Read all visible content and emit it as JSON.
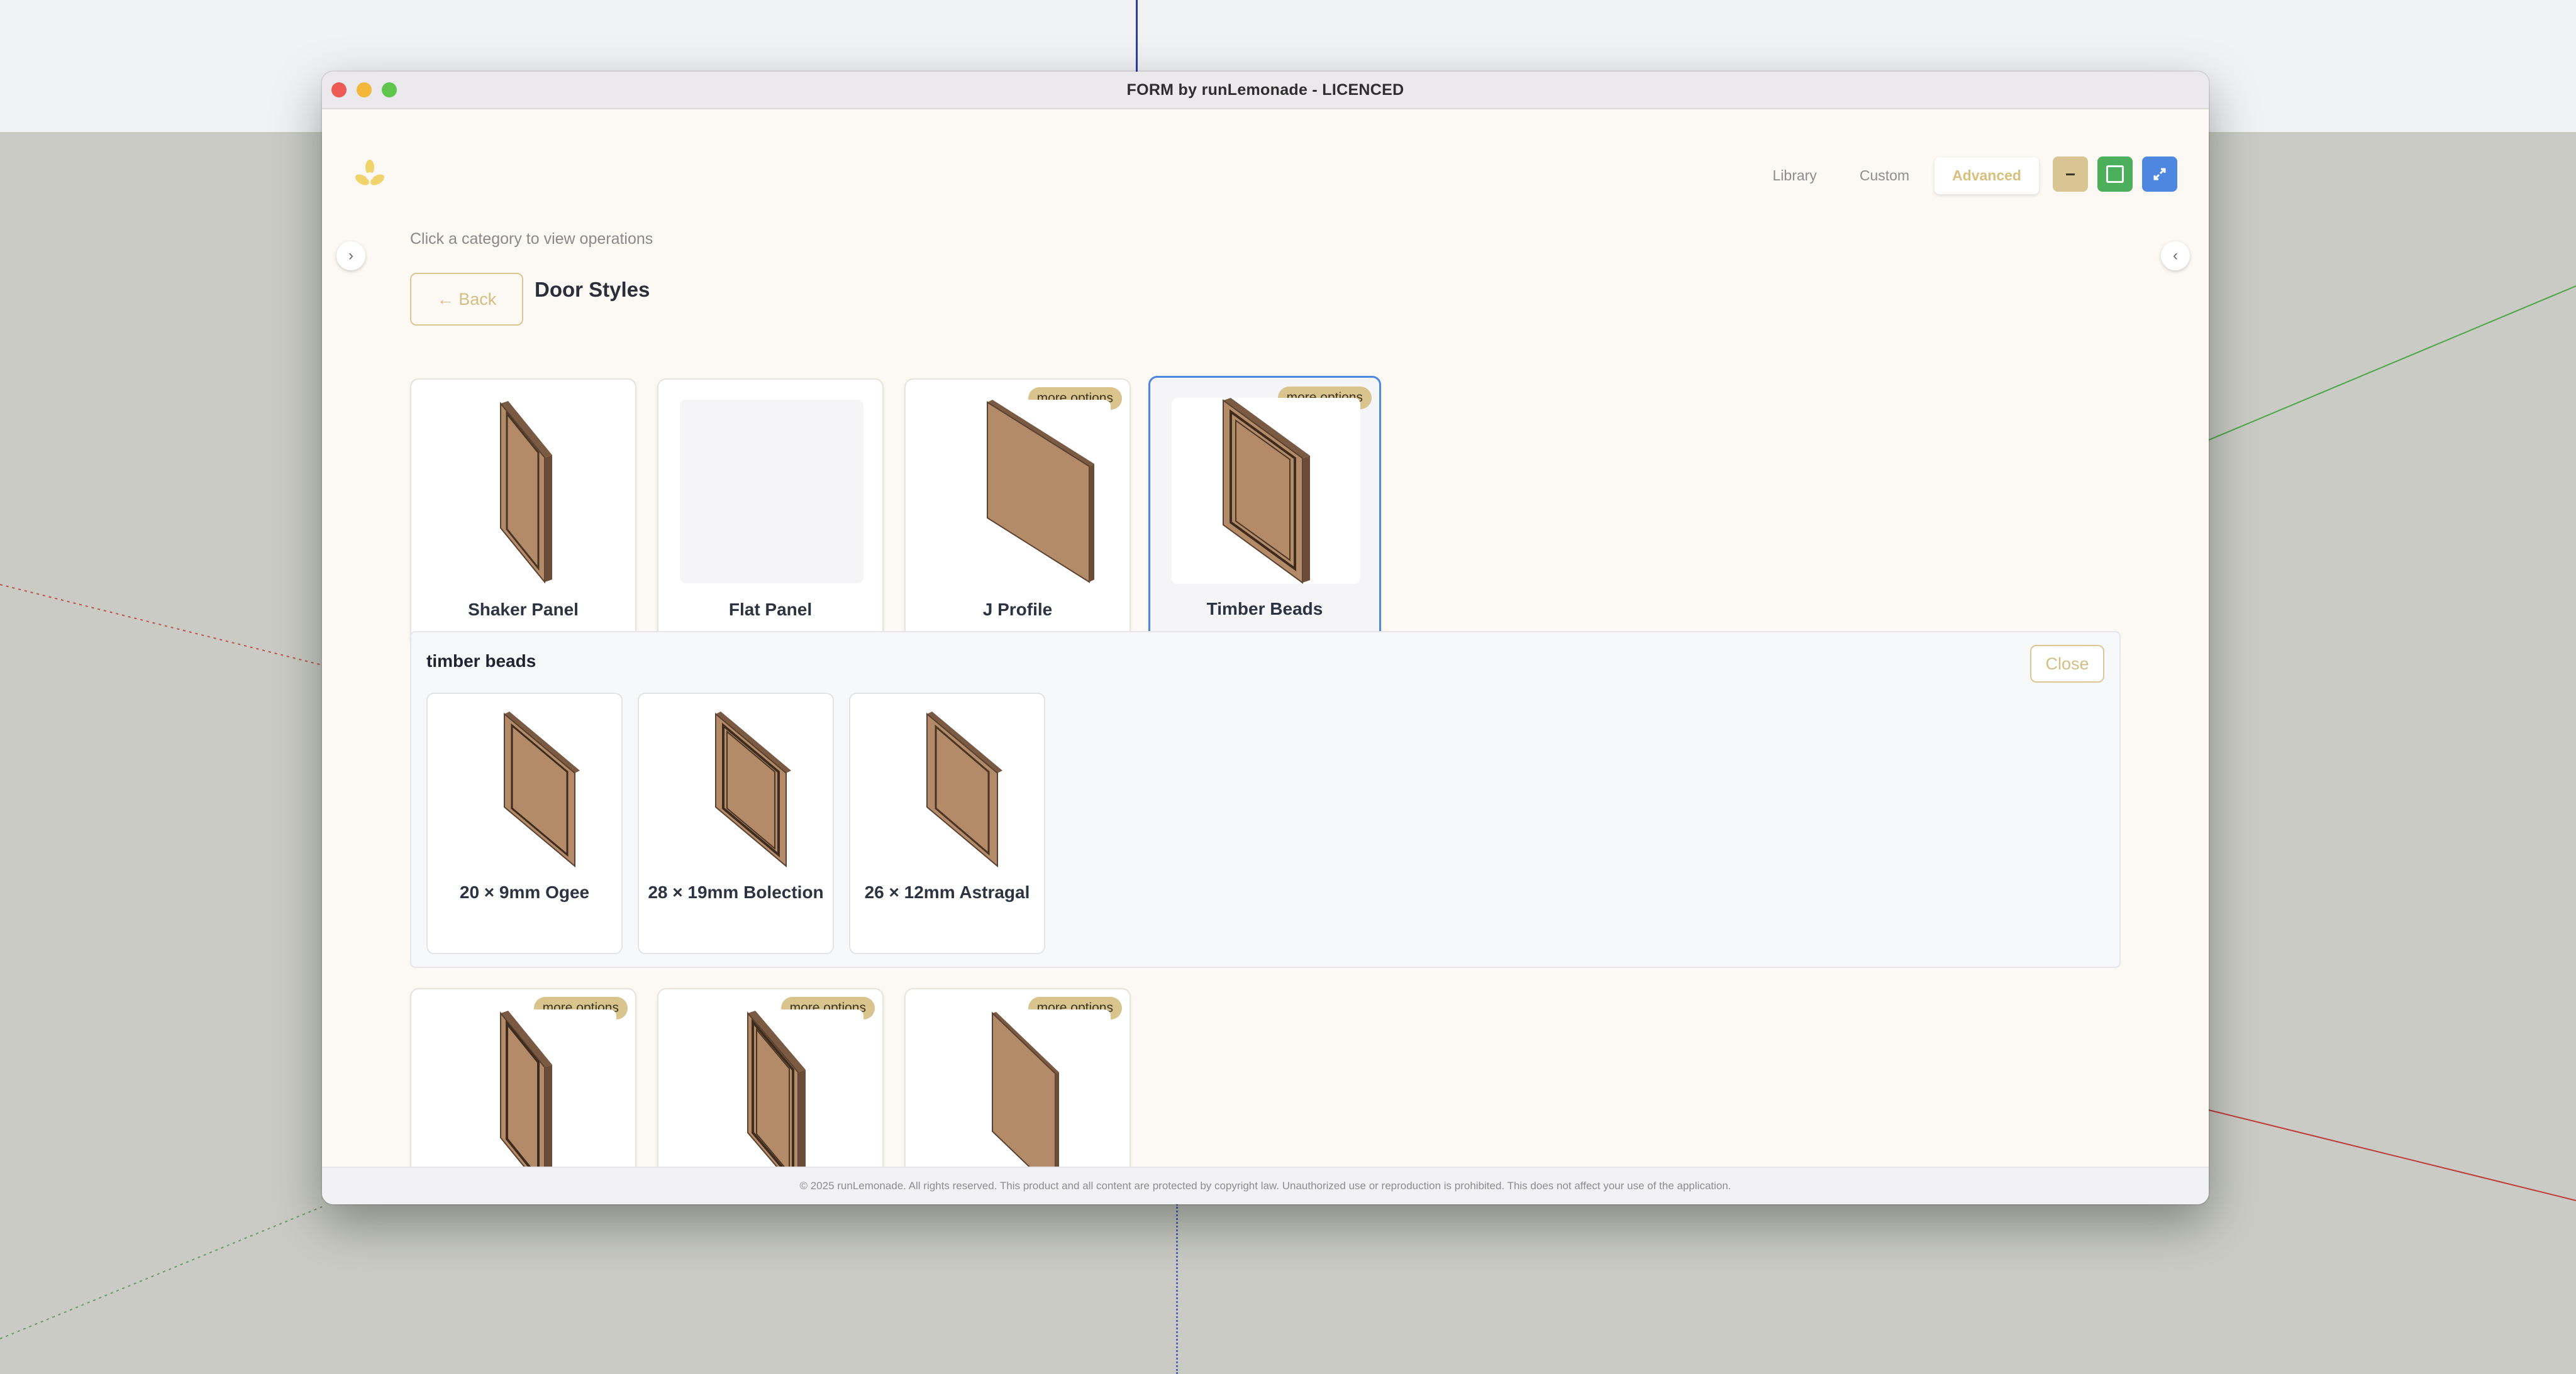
{
  "window": {
    "title": "FORM by runLemonade - LICENCED"
  },
  "nav": {
    "library": "Library",
    "custom": "Custom",
    "advanced": "Advanced",
    "minimize_icon": "minus-icon",
    "maximize_icon": "square-icon",
    "fullscreen_icon": "expand-icon"
  },
  "hint": "Click a category to view operations",
  "back_label": "← Back",
  "section_title": "Door Styles",
  "badge_label": "more options",
  "styles": [
    {
      "name": "Shaker Panel",
      "more_options": false,
      "selected": false
    },
    {
      "name": "Flat Panel",
      "more_options": false,
      "selected": false
    },
    {
      "name": "J Profile",
      "more_options": true,
      "selected": false
    },
    {
      "name": "Timber Beads",
      "more_options": true,
      "selected": true
    }
  ],
  "panel": {
    "title": "timber beads",
    "close_label": "Close",
    "items": [
      {
        "name": "20 × 9mm Ogee"
      },
      {
        "name": "28 × 19mm Bolection"
      },
      {
        "name": "26 × 12mm Astragal"
      }
    ]
  },
  "more_styles": [
    {
      "more_options": true
    },
    {
      "more_options": true
    },
    {
      "more_options": true
    }
  ],
  "footer": "© 2025 runLemonade. All rights reserved. This product and all content are protected by copyright law. Unauthorized use or reproduction is prohibited. This does not affect your use of the application.",
  "colors": {
    "accent_gold": "#d9c48e",
    "selected_border": "#4d86dd",
    "timber": "#b38b68"
  }
}
